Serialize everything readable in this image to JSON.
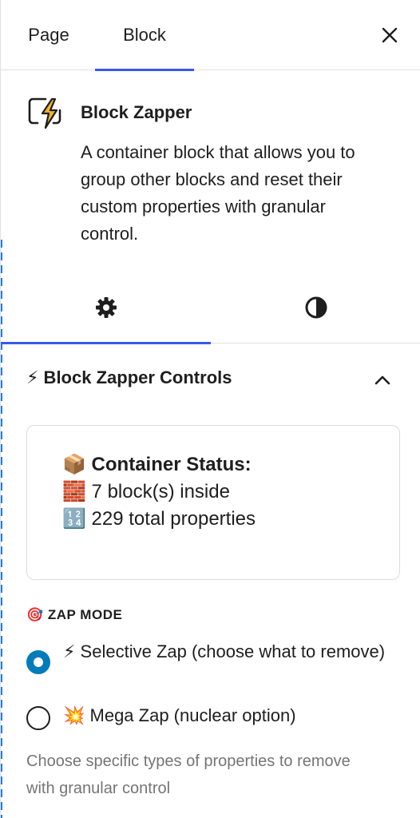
{
  "tabs": {
    "page": "Page",
    "block": "Block",
    "active": "Block"
  },
  "icons": {
    "close": "close-icon",
    "block": "zap-block-icon",
    "settings": "gear-icon",
    "styles": "contrast-icon",
    "collapse": "chevron-up-icon"
  },
  "block": {
    "title": "Block Zapper",
    "description": "A container block that allows you to group other blocks and reset their custom properties with granular control."
  },
  "controls": {
    "title": "⚡ Block Zapper Controls",
    "expanded": true
  },
  "status": {
    "heading": "📦 Container Status:",
    "blocks": "🧱 7 block(s) inside",
    "properties": "🔢 229 total properties"
  },
  "zap_mode": {
    "label": "🎯 ZAP MODE",
    "options": [
      {
        "label": "⚡ Selective Zap (choose what to remove)",
        "checked": true
      },
      {
        "label": "💥 Mega Zap (nuclear option)",
        "checked": false
      }
    ],
    "help": "Choose specific types of properties to remove with granular control"
  },
  "colors": {
    "accent": "#3858e9",
    "radio_checked": "#007cba",
    "help_text": "#757575",
    "icon_bolt": "#f0b429"
  }
}
